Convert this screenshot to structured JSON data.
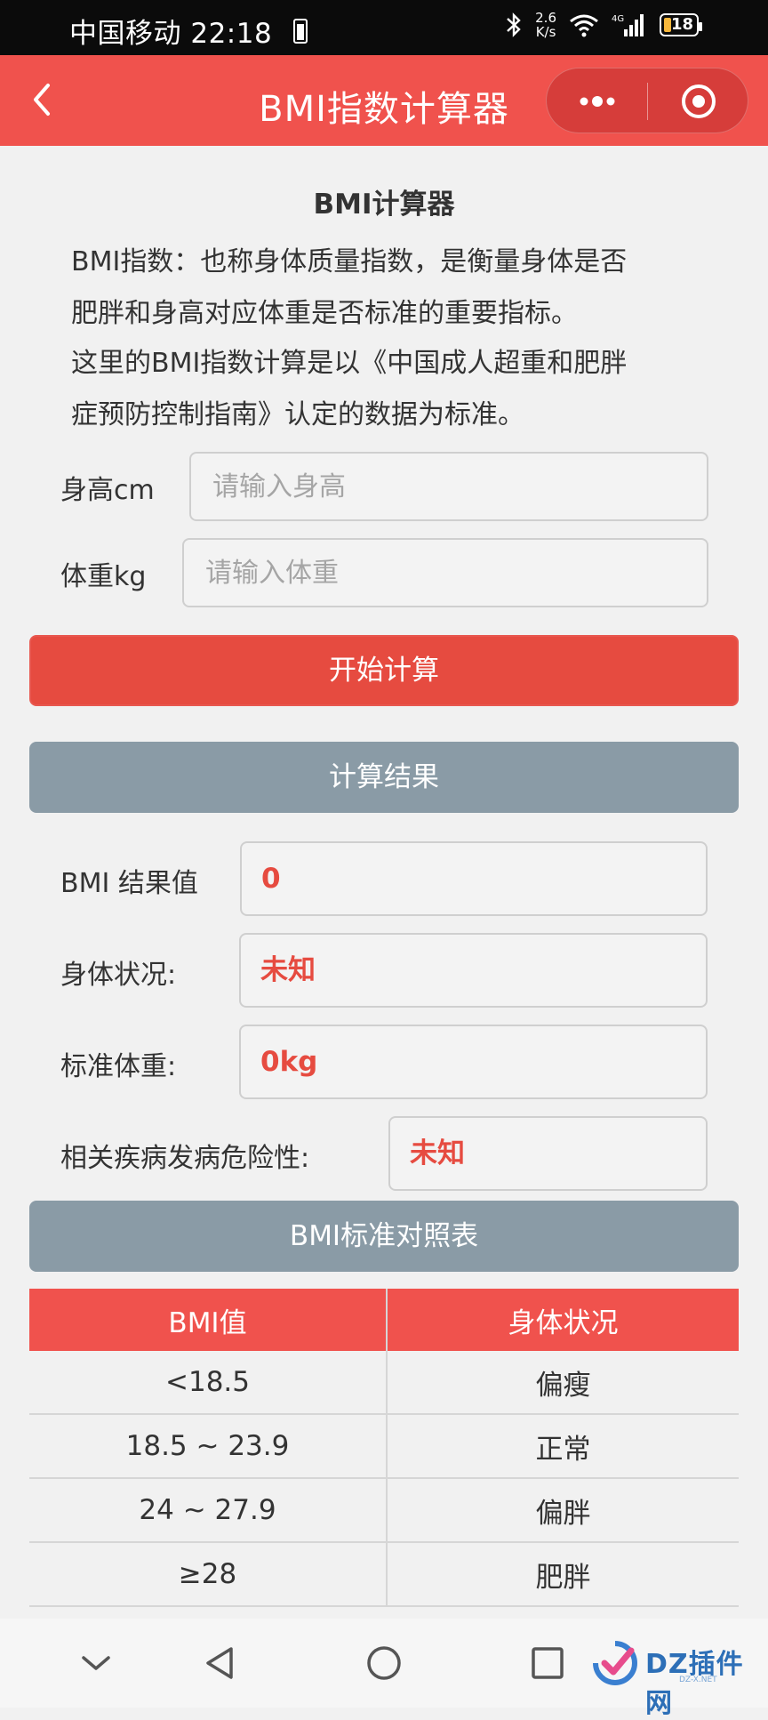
{
  "status_bar": {
    "carrier_time": "中国移动 22:18",
    "speed_value": "2.6",
    "speed_unit": "K/s",
    "network": "4G",
    "battery": "18"
  },
  "header": {
    "title": "BMI指数计算器"
  },
  "page": {
    "title": "BMI计算器",
    "desc_line1": "BMI指数：也称身体质量指数，是衡量身体是否",
    "desc_line2": "肥胖和身高对应体重是否标准的重要指标。",
    "desc_line3": "这里的BMI指数计算是以《中国成人超重和肥胖",
    "desc_line4": "症预防控制指南》认定的数据为标准。"
  },
  "form": {
    "height_label": "身高cm",
    "height_placeholder": "请输入身高",
    "weight_label": "体重kg",
    "weight_placeholder": "请输入体重",
    "calc_button": "开始计算"
  },
  "results": {
    "section_title": "计算结果",
    "bmi_label": "BMI 结果值",
    "bmi_value": "0",
    "status_label": "身体状况:",
    "status_value": "未知",
    "std_weight_label": "标准体重:",
    "std_weight_value": "0kg",
    "risk_label": "相关疾病发病危险性:",
    "risk_value": "未知"
  },
  "table": {
    "section_title": "BMI标准对照表",
    "headers": [
      "BMI值",
      "身体状况"
    ],
    "rows": [
      [
        "<18.5",
        "偏瘦"
      ],
      [
        "18.5 ~ 23.9",
        "正常"
      ],
      [
        "24 ~ 27.9",
        "偏胖"
      ],
      [
        "≥28",
        "肥胖"
      ]
    ]
  },
  "watermark": {
    "text": "DZ插件网",
    "sub": "DZ-X.NET"
  },
  "colors": {
    "accent": "#f0524d",
    "button": "#e64b40",
    "section_bar": "#8a9ba6",
    "result_text": "#e64b40"
  }
}
